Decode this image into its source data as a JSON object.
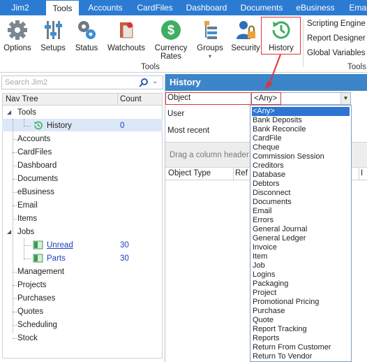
{
  "menu": {
    "tabs": [
      {
        "label": "Jim2",
        "active": false
      },
      {
        "label": "Tools",
        "active": true
      },
      {
        "label": "Accounts",
        "active": false
      },
      {
        "label": "CardFiles",
        "active": false
      },
      {
        "label": "Dashboard",
        "active": false
      },
      {
        "label": "Documents",
        "active": false
      },
      {
        "label": "eBusiness",
        "active": false
      },
      {
        "label": "Emai",
        "active": false
      }
    ]
  },
  "ribbon": {
    "buttons": [
      {
        "label": "Options",
        "icon": "gear-icon"
      },
      {
        "label": "Setups",
        "icon": "sliders-icon"
      },
      {
        "label": "Status",
        "icon": "gears-icon"
      },
      {
        "label": "Watchouts",
        "icon": "watchouts-icon"
      },
      {
        "label": "Currency",
        "label2": "Rates",
        "icon": "currency-icon"
      },
      {
        "label": "Groups",
        "icon": "groups-icon"
      },
      {
        "label": "Security",
        "icon": "security-icon"
      },
      {
        "label": "History",
        "icon": "history-icon"
      }
    ],
    "group_label": "Tools",
    "side_links": [
      "Scripting Engine",
      "Report Designer",
      "Global Variables"
    ],
    "side_group_label": "Tools"
  },
  "nav": {
    "search_placeholder": "Search Jim2",
    "col_tree": "Nav Tree",
    "col_count": "Count",
    "items": [
      {
        "label": "Tools",
        "count": ""
      },
      {
        "label": "History",
        "count": "0"
      },
      {
        "label": "Accounts",
        "count": ""
      },
      {
        "label": "CardFiles",
        "count": ""
      },
      {
        "label": "Dashboard",
        "count": ""
      },
      {
        "label": "Documents",
        "count": ""
      },
      {
        "label": "eBusiness",
        "count": ""
      },
      {
        "label": "Email",
        "count": ""
      },
      {
        "label": "Items",
        "count": ""
      },
      {
        "label": "Jobs",
        "count": ""
      },
      {
        "label": "Unread",
        "count": "30"
      },
      {
        "label": "Parts",
        "count": "30"
      },
      {
        "label": "Management",
        "count": ""
      },
      {
        "label": "Projects",
        "count": ""
      },
      {
        "label": "Purchases",
        "count": ""
      },
      {
        "label": "Quotes",
        "count": ""
      },
      {
        "label": "Scheduling",
        "count": ""
      },
      {
        "label": "Stock",
        "count": ""
      }
    ]
  },
  "history": {
    "title": "History",
    "object_label": "Object",
    "object_value": "<Any>",
    "user_label": "User",
    "most_recent_label": "Most recent",
    "group_hint": "Drag a column header h",
    "grid_cols": [
      "Object Type",
      "Ref",
      "I"
    ]
  },
  "dropdown": {
    "options": [
      "<Any>",
      "Bank Deposits",
      "Bank Reconcile",
      "CardFile",
      "Cheque",
      "Commission Session",
      "Creditors",
      "Database",
      "Debtors",
      "Disconnect",
      "Documents",
      "Email",
      "Errors",
      "General Journal",
      "General Ledger",
      "Invoice",
      "Item",
      "Job",
      "Logins",
      "Packaging",
      "Project",
      "Promotional Pricing",
      "Purchase",
      "Quote",
      "Report Tracking",
      "Reports",
      "Return From Customer",
      "Return To Vendor"
    ]
  },
  "colors": {
    "menubar": "#2b7bd2",
    "panel_header": "#3d85c9",
    "selection": "#2e75d1",
    "highlight": "#e03434"
  }
}
